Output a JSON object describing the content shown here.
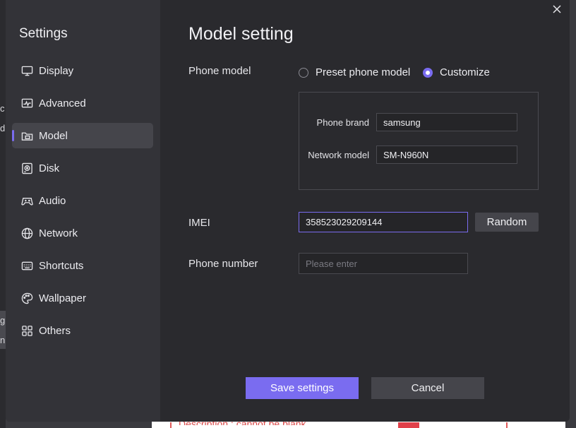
{
  "background": {
    "fragments": [
      "c",
      "d",
      "g",
      "n"
    ],
    "error_text": "Description : cannot be blank"
  },
  "sidebar": {
    "title": "Settings",
    "items": [
      {
        "label": "Display",
        "icon": "monitor-icon",
        "active": false
      },
      {
        "label": "Advanced",
        "icon": "pulse-icon",
        "active": false
      },
      {
        "label": "Model",
        "icon": "folder-icon",
        "active": true
      },
      {
        "label": "Disk",
        "icon": "disk-icon",
        "active": false
      },
      {
        "label": "Audio",
        "icon": "gamepad-icon",
        "active": false
      },
      {
        "label": "Network",
        "icon": "globe-icon",
        "active": false
      },
      {
        "label": "Shortcuts",
        "icon": "keyboard-icon",
        "active": false
      },
      {
        "label": "Wallpaper",
        "icon": "palette-icon",
        "active": false
      },
      {
        "label": "Others",
        "icon": "grid-icon",
        "active": false
      }
    ]
  },
  "main": {
    "title": "Model setting",
    "phone_model": {
      "label": "Phone model",
      "options": [
        {
          "label": "Preset phone model",
          "selected": false
        },
        {
          "label": "Customize",
          "selected": true
        }
      ]
    },
    "phone_brand": {
      "label": "Phone brand",
      "value": "samsung"
    },
    "network_model": {
      "label": "Network model",
      "value": "SM-N960N"
    },
    "imei": {
      "label": "IMEI",
      "value": "358523029209144",
      "random_label": "Random"
    },
    "phone_number": {
      "label": "Phone number",
      "value": "",
      "placeholder": "Please enter"
    },
    "save_label": "Save settings",
    "cancel_label": "Cancel"
  },
  "colors": {
    "accent": "#7a6cf0",
    "dialog_bg": "#2a2a2e",
    "sidebar_bg": "#333338"
  }
}
